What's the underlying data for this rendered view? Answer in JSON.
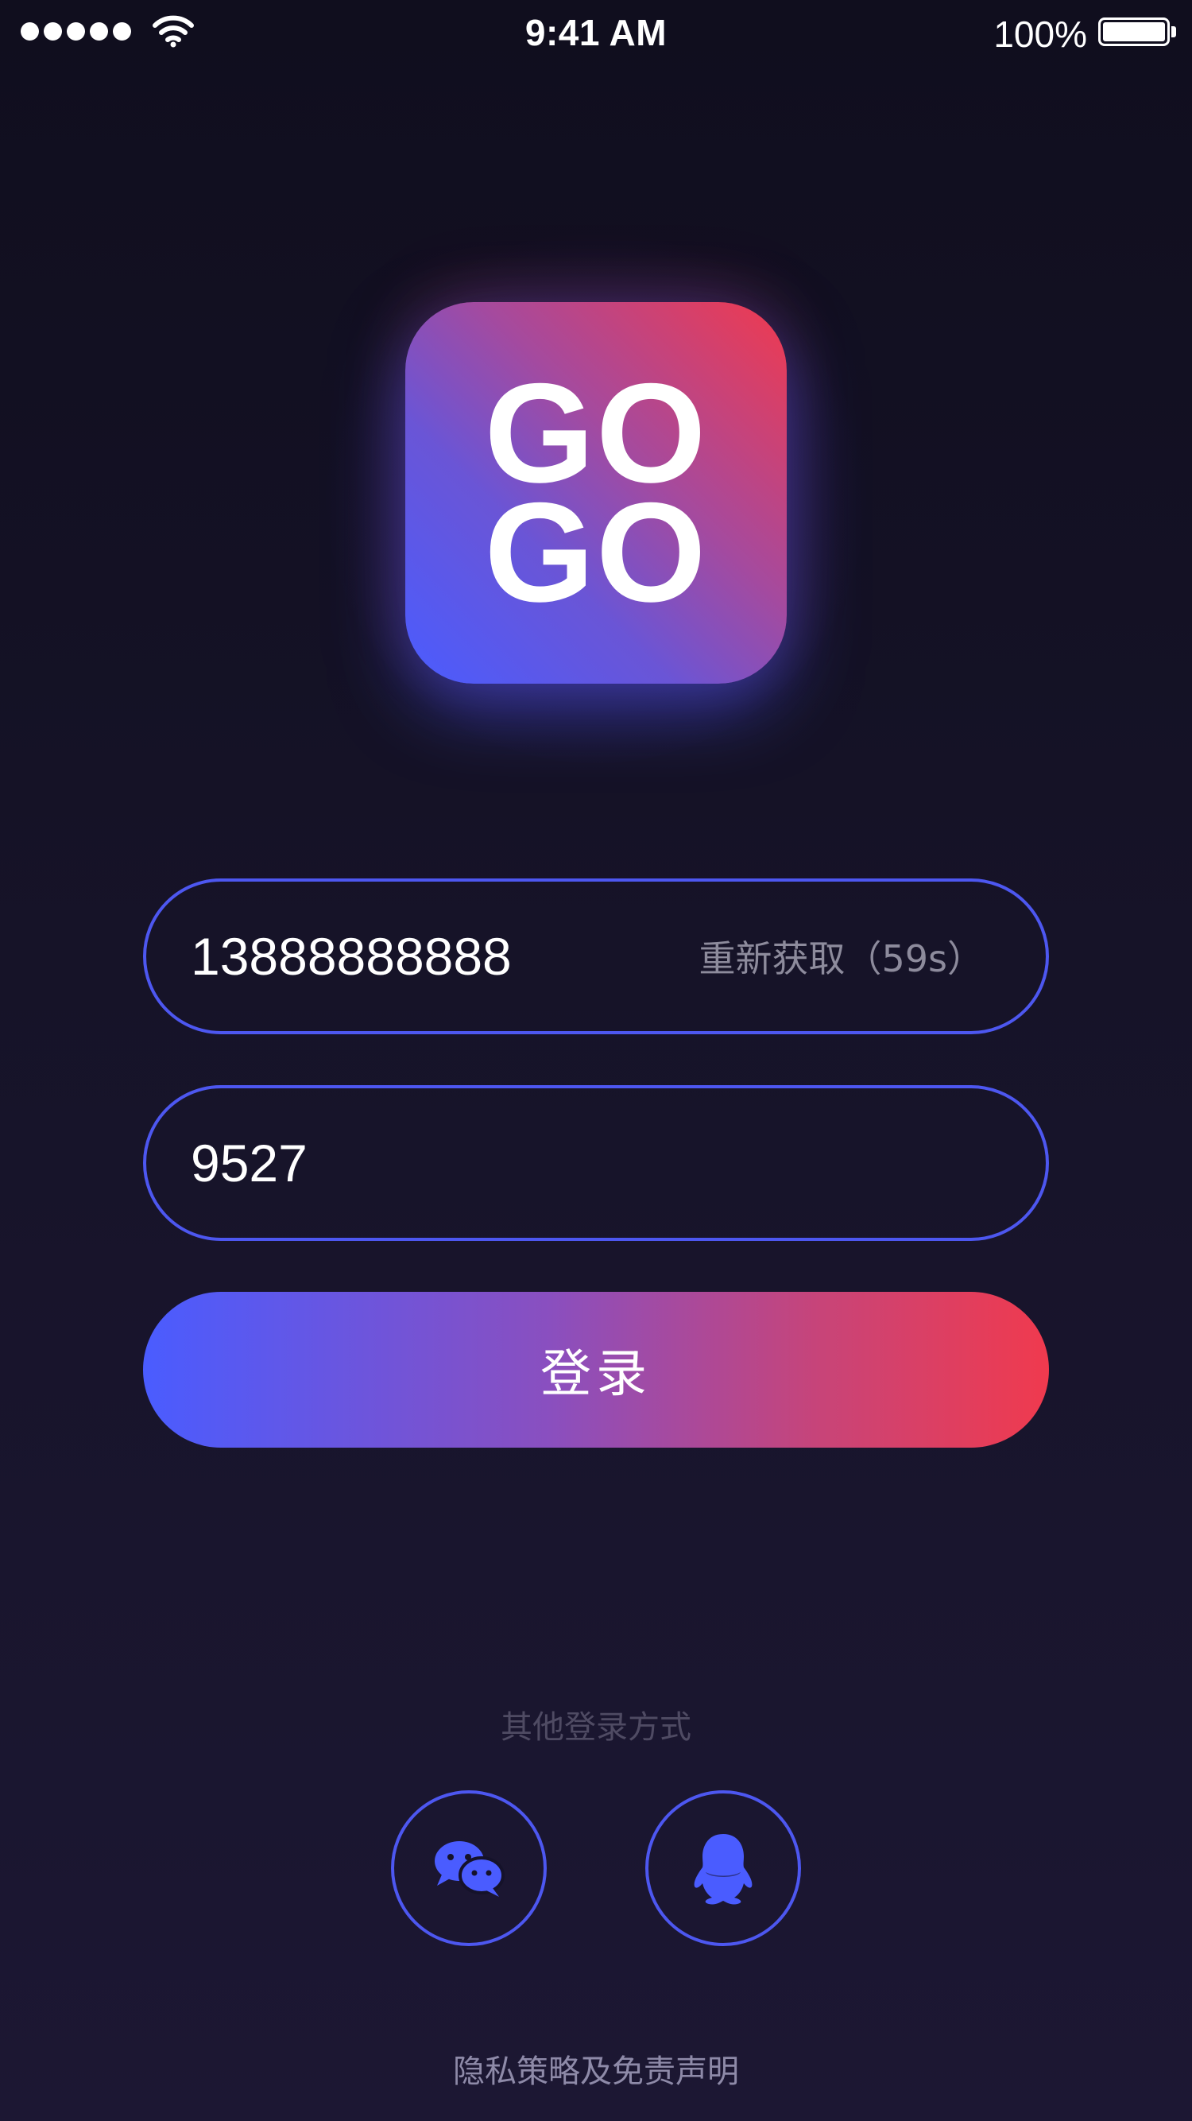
{
  "status_bar": {
    "time": "9:41 AM",
    "battery_percent": "100%",
    "signal_icon": "signal-dots-icon",
    "wifi_icon": "wifi-icon",
    "battery_icon": "battery-icon",
    "battery_level": 1.0
  },
  "logo": {
    "line1": "GO",
    "line2": "GO"
  },
  "phone_field": {
    "value": "13888888888",
    "resend_label": "重新获取（59s）"
  },
  "code_field": {
    "value": "9527"
  },
  "login_button": {
    "label": "登录"
  },
  "other_login": {
    "title": "其他登录方式",
    "options": [
      {
        "icon": "wechat-icon"
      },
      {
        "icon": "qq-icon"
      }
    ]
  },
  "footer": {
    "privacy_link": "隐私策略及免责声明"
  },
  "colors": {
    "background": "#15122a",
    "accent_blue": "#4a5cff",
    "accent_red": "#f03a4e",
    "field_border": "#4d57f0",
    "muted_text": "#8d8b9c"
  }
}
